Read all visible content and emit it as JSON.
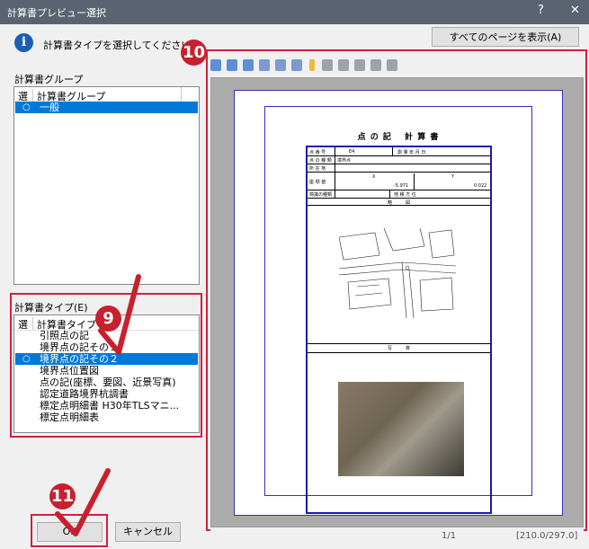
{
  "window": {
    "title": "計算書プレビュー選択",
    "help_label": "?",
    "close_label": "✕"
  },
  "info": {
    "icon": "info-icon",
    "icon_glyph": "i",
    "message": "計算書タイプを選択してください。"
  },
  "show_all_button": "すべてのページを表示(A)",
  "group_section": {
    "label": "計算書グループ",
    "header_select": "選",
    "header_name": "計算書グループ",
    "items": [
      {
        "label": "一般",
        "selected": true
      }
    ]
  },
  "type_section": {
    "label": "計算書タイプ(E)",
    "header_select": "選",
    "header_name": "計算書タイプ",
    "items": [
      {
        "label": "引照点の記",
        "selected": false
      },
      {
        "label": "境界点の記その１",
        "selected": false
      },
      {
        "label": "境界点の記その２",
        "selected": true
      },
      {
        "label": "境界点位置図",
        "selected": false
      },
      {
        "label": "点の記(座標、要図、近景写真)",
        "selected": false
      },
      {
        "label": "認定道路境界杭調書",
        "selected": false
      },
      {
        "label": "標定点明細書 H30年TLSマニ...",
        "selected": false
      },
      {
        "label": "標定点明細表",
        "selected": false
      }
    ]
  },
  "radio_glyph": "○",
  "callouts": {
    "step9": "9",
    "step10": "10",
    "step11": "11",
    "color": "#c8202f"
  },
  "toolbar_icons": [
    "zoom-in-icon",
    "zoom-in-plus-icon",
    "zoom-out-icon",
    "fit-page-icon",
    "page-width-icon",
    "two-page-icon",
    "settings-icon",
    "highlight-icon",
    "first-page-icon",
    "prev-page-icon",
    "next-page-icon",
    "last-page-icon",
    "copy-icon"
  ],
  "document": {
    "title": "点 の 記　 計 算 書",
    "rows": {
      "r1": [
        "点 番 号",
        "E4",
        "測 量 年 月 日",
        ""
      ],
      "r2": [
        "点 の 種 類",
        "境界点",
        "",
        ""
      ],
      "r3": [
        "所 在 地",
        "",
        "",
        ""
      ],
      "r4_head": [
        "X",
        "Y"
      ],
      "r4_label": "座 標 値",
      "r4_vals": [
        "-5.971",
        "0.022"
      ],
      "r5": [
        "標識の種類",
        "",
        "地 積 方 位",
        ""
      ]
    },
    "map_section": "略　　　図",
    "photo_section": "写　　　真"
  },
  "status": {
    "page": "1/1",
    "size": "[210.0/297.0]"
  },
  "ok_button": "OK",
  "cancel_button": "キャンセル",
  "colors": {
    "selection": "#0078d7",
    "titlebar": "#5a6372",
    "callout_red": "#c8202f"
  }
}
